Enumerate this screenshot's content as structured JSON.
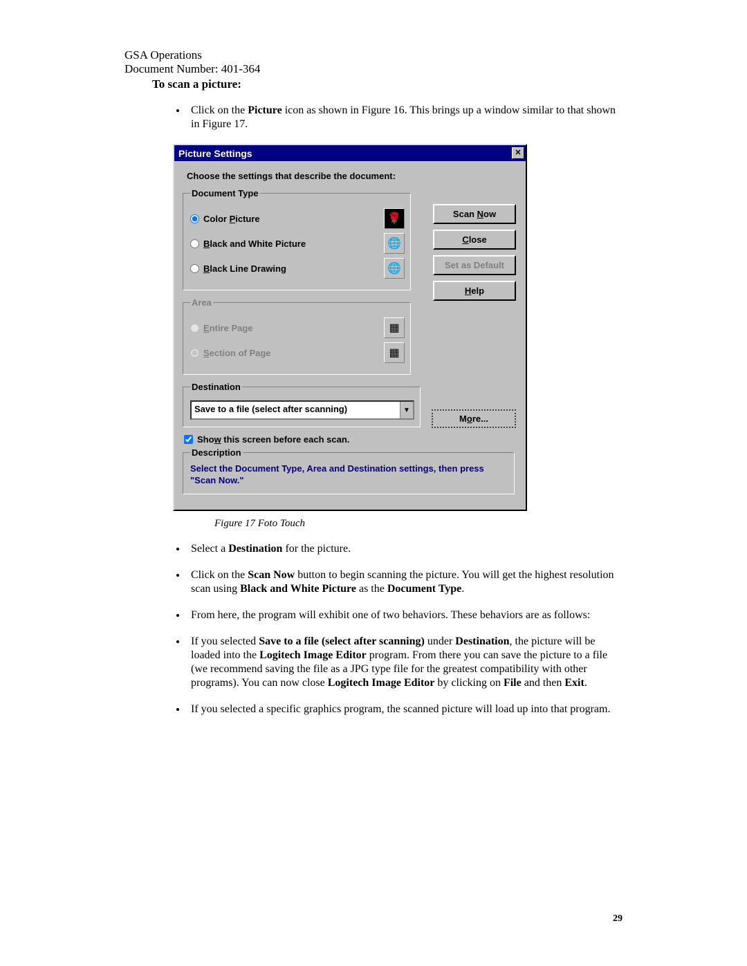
{
  "header": {
    "org": "GSA Operations",
    "docnum": "Document Number: 401-364",
    "heading": "To scan a picture:"
  },
  "intro_bullet": "Click on the <b>Picture</b> icon as shown in Figure 16. This brings up a window similar to that shown in Figure 17.",
  "dialog": {
    "title": "Picture Settings",
    "prompt": "Choose the settings that describe the document:",
    "groups": {
      "doc_type": {
        "legend": "Document Type",
        "options": [
          {
            "label_pre": "Color ",
            "label_u": "P",
            "label_post": "icture",
            "selected": true,
            "enabled": true,
            "thumb": "🌹"
          },
          {
            "label_pre": "",
            "label_u": "B",
            "label_post": "lack and White Picture",
            "selected": false,
            "enabled": true,
            "thumb": "🌐"
          },
          {
            "label_pre": "",
            "label_u": "B",
            "label_post": "lack Line Drawing",
            "selected": false,
            "enabled": true,
            "thumb": "🌐"
          }
        ]
      },
      "area": {
        "legend": "Area",
        "options": [
          {
            "label_pre": "",
            "label_u": "E",
            "label_post": "ntire Page",
            "selected": false,
            "enabled": false,
            "thumb": "▦"
          },
          {
            "label_pre": "",
            "label_u": "S",
            "label_post": "ection of Page",
            "selected": true,
            "enabled": false,
            "thumb": "▦"
          }
        ]
      },
      "destination": {
        "legend": "Destination",
        "value": "Save to a file (select after scanning)"
      },
      "description": {
        "legend": "Description",
        "text": "Select the Document Type, Area and Destination settings, then press \"Scan Now.\""
      }
    },
    "checkbox": {
      "label_pre": "Sho",
      "label_u": "w",
      "label_post": " this screen before each scan.",
      "checked": true
    },
    "buttons": {
      "scan": {
        "pre": "Scan ",
        "u": "N",
        "post": "ow",
        "enabled": true
      },
      "close": {
        "pre": "",
        "u": "C",
        "post": "lose",
        "enabled": true
      },
      "setdef": {
        "text": "Set as Default",
        "enabled": false
      },
      "help": {
        "pre": "",
        "u": "H",
        "post": "elp",
        "enabled": true
      },
      "more": {
        "pre": "M",
        "u": "o",
        "post": "re...",
        "enabled": true
      }
    }
  },
  "caption": "Figure 17 Foto Touch",
  "post_bullets": [
    "Select a <b>Destination</b> for the picture.",
    "Click on the <b>Scan Now</b> button to begin scanning the picture. You will get the highest resolution scan using <b>Black and White Picture</b> as the <b>Document Type</b>.",
    "From here, the program will exhibit one of two behaviors. These behaviors are as follows:",
    "If you selected <b>Save to a file (select after scanning)</b> under <b>Destination</b>, the picture will be loaded into the <b>Logitech Image Editor</b> program. From there you can save the picture to a file (we recommend saving the file as a JPG type file for the greatest compatibility with other programs). You can now close <b>Logitech Image Editor</b> by clicking on <b>File</b> and then <b>Exit</b>.",
    "If you selected a specific graphics program, the scanned picture will load up into that program."
  ],
  "page_number": "29"
}
